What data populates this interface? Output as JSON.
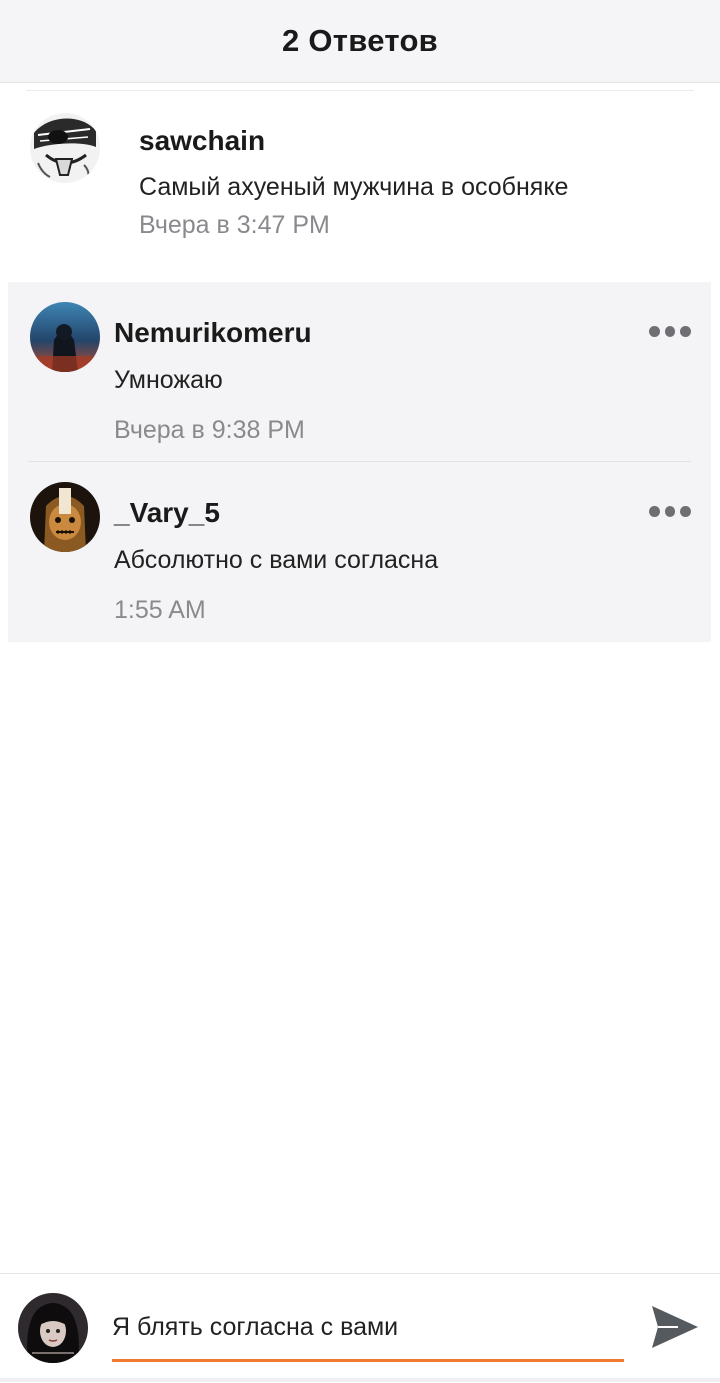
{
  "header": {
    "title": "2 Ответов"
  },
  "parent_comment": {
    "username": "sawchain",
    "text": "Самый ахуеный мужчина в особняке",
    "time": "Вчера в 3:47 PM"
  },
  "replies": [
    {
      "username": "Nemurikomeru",
      "text": "Умножаю",
      "time": "Вчера в 9:38 PM"
    },
    {
      "username": "_Vary_5",
      "text": "Абсолютно с вами согласна",
      "time": "1:55 AM"
    }
  ],
  "composer": {
    "value": "Я блять согласна с вами"
  },
  "colors": {
    "accent": "#f07a30",
    "header_bg": "#f5f5f7",
    "reply_bg": "#f4f4f6",
    "timestamp": "#8a8a8e",
    "send_icon": "#555a5f"
  },
  "icons": {
    "more": "more-dots-icon",
    "send": "send-icon"
  }
}
